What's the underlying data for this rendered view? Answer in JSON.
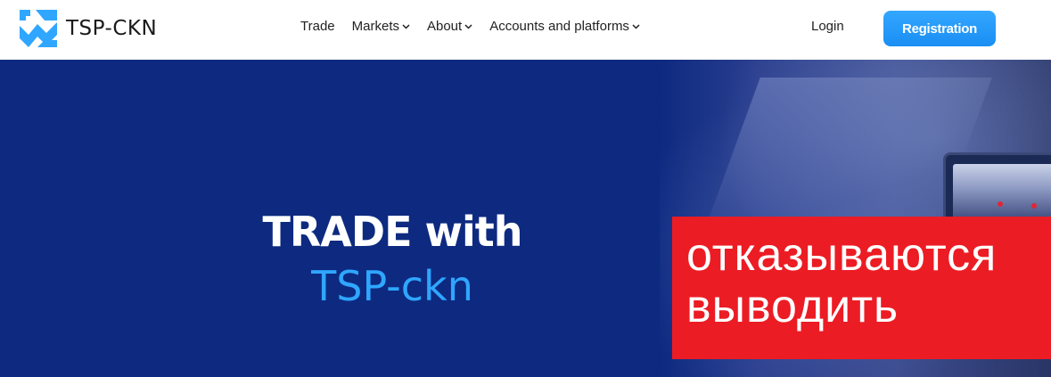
{
  "header": {
    "logo_text": "TSP-CKN",
    "nav": [
      {
        "label": "Trade",
        "has_dropdown": false
      },
      {
        "label": "Markets",
        "has_dropdown": true
      },
      {
        "label": "About",
        "has_dropdown": true
      },
      {
        "label": "Accounts and platforms",
        "has_dropdown": true
      }
    ],
    "login_label": "Login",
    "registration_label": "Registration"
  },
  "hero": {
    "title": "TRADE with",
    "subtitle": "TSP-ckn"
  },
  "overlay": {
    "line1": "отказываются",
    "line2": "выводить"
  },
  "colors": {
    "brand_blue": "#1a8ef3",
    "hero_background": "#0d2a80",
    "accent_text": "#2fa6ff",
    "overlay_red": "#ec1c24"
  }
}
